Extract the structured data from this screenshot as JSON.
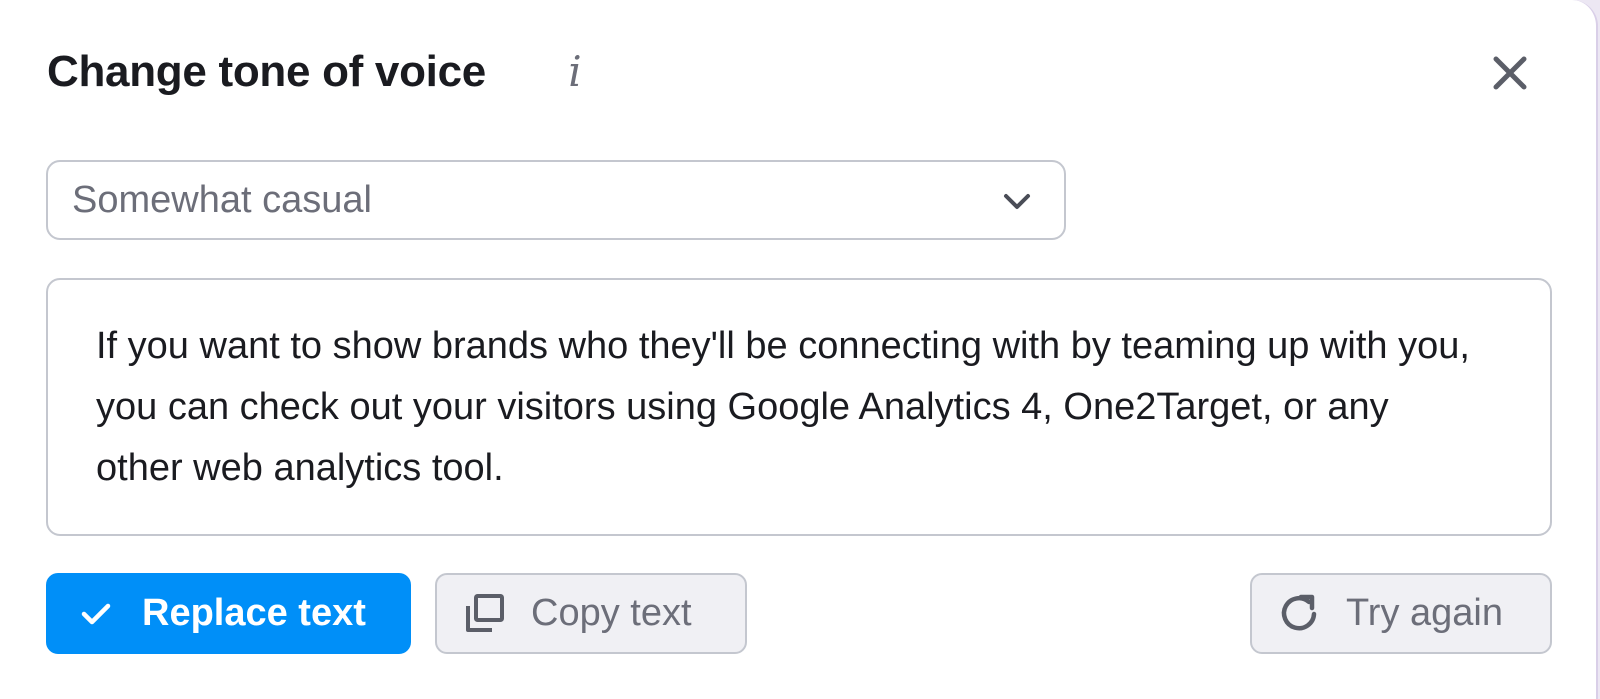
{
  "dialog": {
    "title": "Change tone of voice",
    "info_glyph": "i",
    "close_glyph": "×"
  },
  "tone_select": {
    "selected": "Somewhat casual"
  },
  "output": {
    "text": "If you want to show brands who they'll be connecting with by teaming up with you, you can check out your visitors using Google Analytics 4, One2Target, or any other web analytics tool."
  },
  "actions": {
    "replace_label": "Replace text",
    "copy_label": "Copy text",
    "retry_label": "Try again"
  },
  "icons": {
    "info": "info-icon",
    "close": "close-icon",
    "chevron": "chevron-down-icon",
    "check": "check-icon",
    "copy": "copy-icon",
    "retry": "refresh-icon"
  },
  "colors": {
    "primary": "#008ff8",
    "text": "#1a1b20",
    "muted": "#6c6e79",
    "border": "#c4c7cf",
    "secondary_bg": "#f0f0f4"
  }
}
